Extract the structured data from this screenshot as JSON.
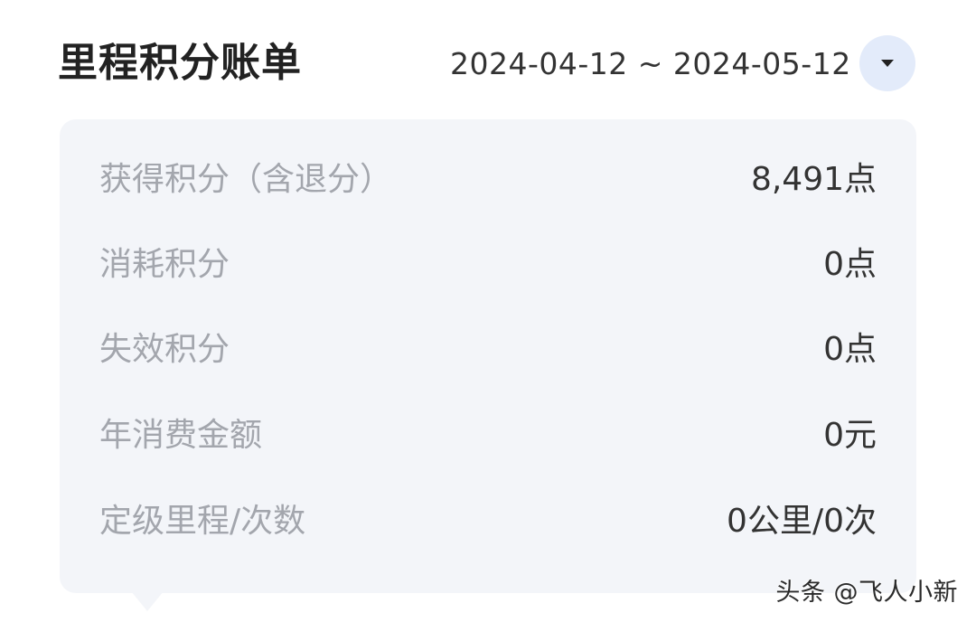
{
  "header": {
    "title": "里程积分账单",
    "date_range": "2024-04-12 ~ 2024-05-12",
    "dropdown_icon": "caret-down-icon"
  },
  "summary": {
    "rows": [
      {
        "label": "获得积分（含退分）",
        "value": "8,491点"
      },
      {
        "label": "消耗积分",
        "value": "0点"
      },
      {
        "label": "失效积分",
        "value": "0点"
      },
      {
        "label": "年消费金额",
        "value": "0元"
      },
      {
        "label": "定级里程/次数",
        "value": "0公里/0次"
      }
    ]
  },
  "watermark": "头条 @飞人小新",
  "colors": {
    "card_background": "#f3f5f9",
    "dropdown_background": "#e3ebfa",
    "label_text": "#a3a6ad",
    "value_text": "#333333",
    "title_text": "#222222"
  }
}
